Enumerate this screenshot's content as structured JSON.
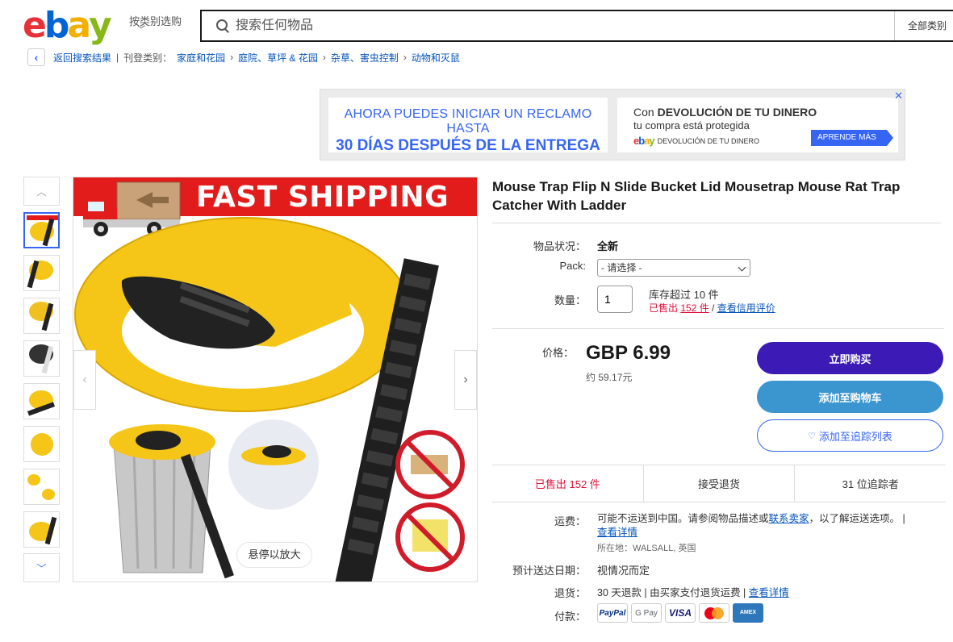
{
  "header": {
    "logo_text": "ebay",
    "logo_colors": [
      "#e53238",
      "#0064d2",
      "#f5af02",
      "#86b817"
    ],
    "shop_by_category": "按类别选购",
    "search_placeholder": "搜索任何物品",
    "all_categories": "全部类别"
  },
  "breadcrumb": {
    "back": "返回搜索结果",
    "listed_in": "刊登类别：",
    "items": [
      "家庭和花园",
      "庭院、草坪 & 花园",
      "杂草、害虫控制",
      "动物和灭鼠"
    ]
  },
  "banner": {
    "left_line1": "AHORA PUEDES INICIAR UN RECLAMO HASTA",
    "left_line2": "30 DÍAS DESPUÉS DE LA ENTREGA",
    "right_line1_prefix": "Con ",
    "right_line1_bold": "DEVOLUCIÓN DE TU DINERO",
    "right_line2": "tu compra está protegida",
    "right_logo": "ebay",
    "right_tag": "DEVOLUCIÓN DE TU DINERO",
    "learn_more": "APRENDE MÁS",
    "close": "✕"
  },
  "gallery": {
    "fast_shipping": "FAST SHIPPING",
    "zoom_hint": "悬停以放大",
    "thumbnail_count": 8,
    "active_thumbnail": 1
  },
  "product": {
    "title": "Mouse Trap Flip N Slide Bucket Lid Mousetrap Mouse Rat Trap Catcher With Ladder",
    "condition_label": "物品状况：",
    "condition_value": "全新",
    "pack_label": "Pack:",
    "pack_value": "- 请选择 -",
    "quantity_label": "数量：",
    "quantity_value": "1",
    "stock": "库存超过 10 件",
    "sold_prefix": "已售出 ",
    "sold_count": "152 件",
    "slash": " / ",
    "view_feedback": "查看信用评价",
    "price_label": "价格：",
    "price": "GBP 6.99",
    "approx_price": "约 59.17元",
    "buy_now": "立即购买",
    "add_to_cart": "添加至购物车",
    "add_to_watchlist": "添加至追踪列表"
  },
  "stats": {
    "sold": "已售出 152 件",
    "returns": "接受退货",
    "watchers": "31 位追踪者"
  },
  "shipping": {
    "label": "运费：",
    "text_prefix": "可能不运送到中国。请参阅物品描述或",
    "contact_seller": "联系卖家",
    "text_suffix": "，以了解运送选项。 |",
    "see_details": "查看详情",
    "location": "所在地：WALSALL, 英国"
  },
  "delivery": {
    "label": "预计送达日期：",
    "value": "视情况而定"
  },
  "returns": {
    "label": "退货：",
    "value": "30 天退款 | 由买家支付退货运费 | ",
    "see_details": "查看详情"
  },
  "payments": {
    "label": "付款：",
    "methods": [
      "PayPal",
      "G Pay",
      "VISA",
      "Mastercard",
      "AMEX"
    ]
  }
}
